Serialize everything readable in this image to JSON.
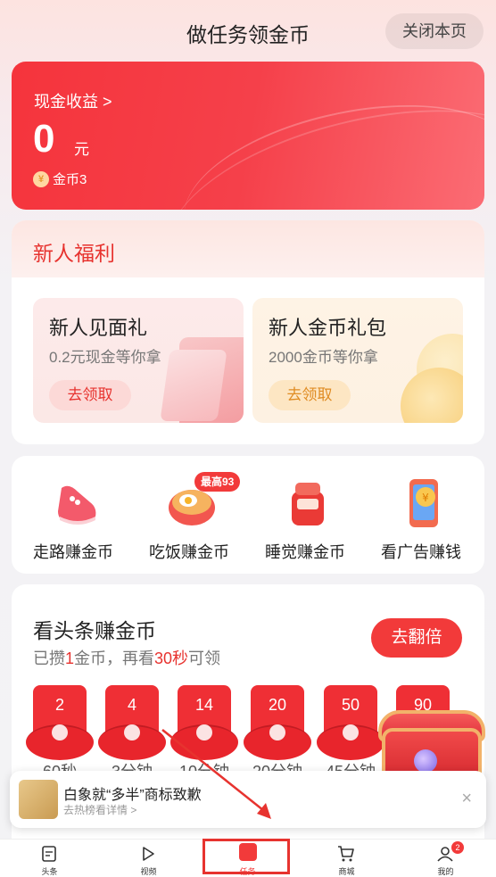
{
  "header": {
    "title": "做任务领金币",
    "close_label": "关闭本页"
  },
  "cash": {
    "label": "现金收益 >",
    "amount": "0",
    "unit": "元",
    "coin_symbol": "¥",
    "coins": "金币3"
  },
  "newbie": {
    "title": "新人福利",
    "gifts": [
      {
        "title": "新人见面礼",
        "subtitle": "0.2元现金等你拿",
        "button": "去领取"
      },
      {
        "title": "新人金币礼包",
        "subtitle": "2000金币等你拿",
        "button": "去领取"
      }
    ]
  },
  "earn": {
    "items": [
      {
        "label": "走路赚金币",
        "icon": "sneaker-icon"
      },
      {
        "label": "吃饭赚金币",
        "icon": "meal-icon"
      },
      {
        "label": "睡觉赚金币",
        "icon": "alarm-clock-icon"
      },
      {
        "label": "看广告赚钱",
        "icon": "phone-coin-icon"
      }
    ],
    "badge": "最高93"
  },
  "news": {
    "title": "看头条赚金币",
    "subtitle_prefix": "已攒",
    "subtitle_coin": "1",
    "subtitle_mid": "金币，再看",
    "subtitle_time": "30秒",
    "subtitle_suffix": "可领",
    "double_button": "去翻倍",
    "packets": [
      {
        "value": "2",
        "label": "60秒"
      },
      {
        "value": "4",
        "label": "3分钟"
      },
      {
        "value": "14",
        "label": "10分钟"
      },
      {
        "value": "20",
        "label": "20分钟"
      },
      {
        "value": "50",
        "label": "45分钟"
      },
      {
        "value": "90",
        "label": ""
      }
    ]
  },
  "toast": {
    "title": "白象就“多半”商标致歉",
    "subtitle": "去热榜看详情 >",
    "close": "×"
  },
  "tabbar": {
    "tabs": [
      {
        "label": "头条",
        "icon": "news-icon"
      },
      {
        "label": "视频",
        "icon": "play-icon"
      },
      {
        "label": "任务",
        "icon": "task-check-icon"
      },
      {
        "label": "商城",
        "icon": "cart-icon"
      },
      {
        "label": "我的",
        "icon": "user-icon"
      }
    ],
    "profile_badge": "2"
  },
  "colors": {
    "accent": "#f23a3a",
    "annotation": "#e7332f"
  }
}
